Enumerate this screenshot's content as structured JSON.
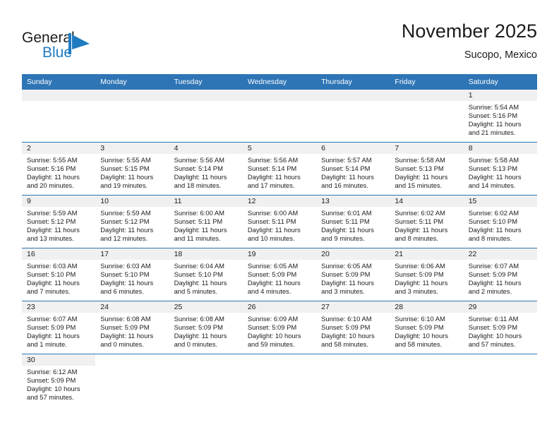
{
  "brand": {
    "name_part1": "General",
    "name_part2": "Blue",
    "mark_icon": "blue-triangle-flag-icon",
    "accent_color": "#1f7bc1"
  },
  "header": {
    "title": "November 2025",
    "subtitle": "Sucopo, Mexico"
  },
  "theme": {
    "header_bar_color": "#2e75b6",
    "daynum_band_color": "#f0f0f0",
    "row_divider_color": "#2e75b6",
    "text_color": "#1c1c1c"
  },
  "weekdays": [
    "Sunday",
    "Monday",
    "Tuesday",
    "Wednesday",
    "Thursday",
    "Friday",
    "Saturday"
  ],
  "weeks": [
    [
      {
        "blank": true
      },
      {
        "blank": true
      },
      {
        "blank": true
      },
      {
        "blank": true
      },
      {
        "blank": true
      },
      {
        "blank": true
      },
      {
        "day": "1",
        "sunrise": "Sunrise: 5:54 AM",
        "sunset": "Sunset: 5:16 PM",
        "daylight1": "Daylight: 11 hours",
        "daylight2": "and 21 minutes."
      }
    ],
    [
      {
        "day": "2",
        "sunrise": "Sunrise: 5:55 AM",
        "sunset": "Sunset: 5:16 PM",
        "daylight1": "Daylight: 11 hours",
        "daylight2": "and 20 minutes."
      },
      {
        "day": "3",
        "sunrise": "Sunrise: 5:55 AM",
        "sunset": "Sunset: 5:15 PM",
        "daylight1": "Daylight: 11 hours",
        "daylight2": "and 19 minutes."
      },
      {
        "day": "4",
        "sunrise": "Sunrise: 5:56 AM",
        "sunset": "Sunset: 5:14 PM",
        "daylight1": "Daylight: 11 hours",
        "daylight2": "and 18 minutes."
      },
      {
        "day": "5",
        "sunrise": "Sunrise: 5:56 AM",
        "sunset": "Sunset: 5:14 PM",
        "daylight1": "Daylight: 11 hours",
        "daylight2": "and 17 minutes."
      },
      {
        "day": "6",
        "sunrise": "Sunrise: 5:57 AM",
        "sunset": "Sunset: 5:14 PM",
        "daylight1": "Daylight: 11 hours",
        "daylight2": "and 16 minutes."
      },
      {
        "day": "7",
        "sunrise": "Sunrise: 5:58 AM",
        "sunset": "Sunset: 5:13 PM",
        "daylight1": "Daylight: 11 hours",
        "daylight2": "and 15 minutes."
      },
      {
        "day": "8",
        "sunrise": "Sunrise: 5:58 AM",
        "sunset": "Sunset: 5:13 PM",
        "daylight1": "Daylight: 11 hours",
        "daylight2": "and 14 minutes."
      }
    ],
    [
      {
        "day": "9",
        "sunrise": "Sunrise: 5:59 AM",
        "sunset": "Sunset: 5:12 PM",
        "daylight1": "Daylight: 11 hours",
        "daylight2": "and 13 minutes."
      },
      {
        "day": "10",
        "sunrise": "Sunrise: 5:59 AM",
        "sunset": "Sunset: 5:12 PM",
        "daylight1": "Daylight: 11 hours",
        "daylight2": "and 12 minutes."
      },
      {
        "day": "11",
        "sunrise": "Sunrise: 6:00 AM",
        "sunset": "Sunset: 5:11 PM",
        "daylight1": "Daylight: 11 hours",
        "daylight2": "and 11 minutes."
      },
      {
        "day": "12",
        "sunrise": "Sunrise: 6:00 AM",
        "sunset": "Sunset: 5:11 PM",
        "daylight1": "Daylight: 11 hours",
        "daylight2": "and 10 minutes."
      },
      {
        "day": "13",
        "sunrise": "Sunrise: 6:01 AM",
        "sunset": "Sunset: 5:11 PM",
        "daylight1": "Daylight: 11 hours",
        "daylight2": "and 9 minutes."
      },
      {
        "day": "14",
        "sunrise": "Sunrise: 6:02 AM",
        "sunset": "Sunset: 5:11 PM",
        "daylight1": "Daylight: 11 hours",
        "daylight2": "and 8 minutes."
      },
      {
        "day": "15",
        "sunrise": "Sunrise: 6:02 AM",
        "sunset": "Sunset: 5:10 PM",
        "daylight1": "Daylight: 11 hours",
        "daylight2": "and 8 minutes."
      }
    ],
    [
      {
        "day": "16",
        "sunrise": "Sunrise: 6:03 AM",
        "sunset": "Sunset: 5:10 PM",
        "daylight1": "Daylight: 11 hours",
        "daylight2": "and 7 minutes."
      },
      {
        "day": "17",
        "sunrise": "Sunrise: 6:03 AM",
        "sunset": "Sunset: 5:10 PM",
        "daylight1": "Daylight: 11 hours",
        "daylight2": "and 6 minutes."
      },
      {
        "day": "18",
        "sunrise": "Sunrise: 6:04 AM",
        "sunset": "Sunset: 5:10 PM",
        "daylight1": "Daylight: 11 hours",
        "daylight2": "and 5 minutes."
      },
      {
        "day": "19",
        "sunrise": "Sunrise: 6:05 AM",
        "sunset": "Sunset: 5:09 PM",
        "daylight1": "Daylight: 11 hours",
        "daylight2": "and 4 minutes."
      },
      {
        "day": "20",
        "sunrise": "Sunrise: 6:05 AM",
        "sunset": "Sunset: 5:09 PM",
        "daylight1": "Daylight: 11 hours",
        "daylight2": "and 3 minutes."
      },
      {
        "day": "21",
        "sunrise": "Sunrise: 6:06 AM",
        "sunset": "Sunset: 5:09 PM",
        "daylight1": "Daylight: 11 hours",
        "daylight2": "and 3 minutes."
      },
      {
        "day": "22",
        "sunrise": "Sunrise: 6:07 AM",
        "sunset": "Sunset: 5:09 PM",
        "daylight1": "Daylight: 11 hours",
        "daylight2": "and 2 minutes."
      }
    ],
    [
      {
        "day": "23",
        "sunrise": "Sunrise: 6:07 AM",
        "sunset": "Sunset: 5:09 PM",
        "daylight1": "Daylight: 11 hours",
        "daylight2": "and 1 minute."
      },
      {
        "day": "24",
        "sunrise": "Sunrise: 6:08 AM",
        "sunset": "Sunset: 5:09 PM",
        "daylight1": "Daylight: 11 hours",
        "daylight2": "and 0 minutes."
      },
      {
        "day": "25",
        "sunrise": "Sunrise: 6:08 AM",
        "sunset": "Sunset: 5:09 PM",
        "daylight1": "Daylight: 11 hours",
        "daylight2": "and 0 minutes."
      },
      {
        "day": "26",
        "sunrise": "Sunrise: 6:09 AM",
        "sunset": "Sunset: 5:09 PM",
        "daylight1": "Daylight: 10 hours",
        "daylight2": "and 59 minutes."
      },
      {
        "day": "27",
        "sunrise": "Sunrise: 6:10 AM",
        "sunset": "Sunset: 5:09 PM",
        "daylight1": "Daylight: 10 hours",
        "daylight2": "and 58 minutes."
      },
      {
        "day": "28",
        "sunrise": "Sunrise: 6:10 AM",
        "sunset": "Sunset: 5:09 PM",
        "daylight1": "Daylight: 10 hours",
        "daylight2": "and 58 minutes."
      },
      {
        "day": "29",
        "sunrise": "Sunrise: 6:11 AM",
        "sunset": "Sunset: 5:09 PM",
        "daylight1": "Daylight: 10 hours",
        "daylight2": "and 57 minutes."
      }
    ],
    [
      {
        "day": "30",
        "sunrise": "Sunrise: 6:12 AM",
        "sunset": "Sunset: 5:09 PM",
        "daylight1": "Daylight: 10 hours",
        "daylight2": "and 57 minutes."
      },
      {
        "blank": true
      },
      {
        "blank": true
      },
      {
        "blank": true
      },
      {
        "blank": true
      },
      {
        "blank": true
      },
      {
        "blank": true
      }
    ]
  ]
}
